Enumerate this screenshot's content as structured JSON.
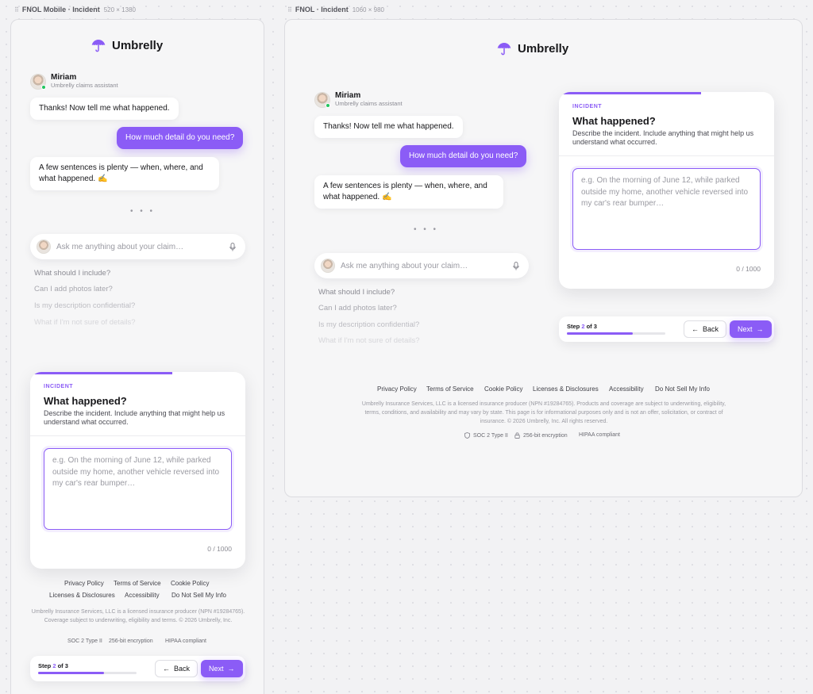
{
  "frames": {
    "mobile": {
      "name": "FNOL Mobile · Incident",
      "dims": "520 × 1380"
    },
    "desktop": {
      "name": "FNOL · Incident",
      "dims": "1060 × 980"
    }
  },
  "brand": {
    "name": "Umbrelly",
    "accent": "#8b5cf6"
  },
  "agent": {
    "name": "Miriam",
    "role": "Umbrelly claims assistant"
  },
  "chat": {
    "messages": [
      {
        "from": "agent",
        "text": "Thanks! Now tell me what happened."
      },
      {
        "from": "user",
        "text": "How much detail do you need?"
      },
      {
        "from": "agent",
        "text": "A few sentences is plenty — when, where, and what happened. ✍️"
      }
    ],
    "typing": "• • •"
  },
  "ask": {
    "placeholder": "Ask me anything about your claim…"
  },
  "suggestions": [
    "What should I include?",
    "Can I add photos later?",
    "Is my description confidential?",
    "What if I'm not sure of details?"
  ],
  "incident": {
    "eyebrow": "INCIDENT",
    "title": "What happened?",
    "description": "Describe the incident. Include anything that might help us understand what occurred.",
    "placeholder": "e.g. On the morning of June 12, while parked outside my home, another vehicle reversed into my car's rear bumper…",
    "counter": "0 / 1000"
  },
  "steps": {
    "label_prefix": "Step ",
    "current": "2",
    "label_suffix": " of 3",
    "progress": 0.667,
    "back_label": "Back",
    "next_label": "Next"
  },
  "footer": {
    "links": [
      "Privacy Policy",
      "Terms of Service",
      "Cookie Policy",
      "Licenses & Disclosures",
      "Accessibility",
      "Do Not Sell My Info"
    ],
    "legal_desktop": "Umbrelly Insurance Services, LLC is a licensed insurance producer (NPN #19284765). Products and coverage are subject to underwriting, eligibility, terms, conditions, and availability and may vary by state. This page is for informational purposes only and is not an offer, solicitation, or contract of insurance. © 2026 Umbrelly, Inc. All rights reserved.",
    "legal_mobile": "Umbrelly Insurance Services, LLC is a licensed insurance producer (NPN #19284765). Coverage subject to underwriting, eligibility and terms. © 2026 Umbrelly, Inc.",
    "badges": [
      "SOC 2 Type II",
      "256-bit encryption",
      "HIPAA compliant"
    ]
  }
}
